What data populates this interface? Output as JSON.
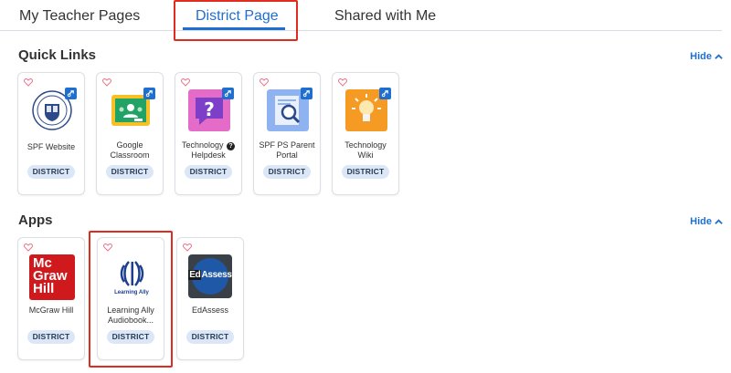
{
  "tabs": [
    {
      "label": "My Teacher Pages"
    },
    {
      "label": "District Page"
    },
    {
      "label": "Shared with Me"
    }
  ],
  "quick_links": {
    "title": "Quick Links",
    "hide_label": "Hide",
    "cards": [
      {
        "label": "SPF Website",
        "badge": "DISTRICT",
        "icon": "spf-seal-icon"
      },
      {
        "label": "Google Classroom",
        "badge": "DISTRICT",
        "icon": "google-classroom-icon"
      },
      {
        "label": "Technology",
        "badge": "DISTRICT",
        "icon": "helpdesk-question-icon"
      },
      {
        "label": "SPF PS Parent Portal",
        "badge": "DISTRICT",
        "icon": "parent-portal-magnifier-icon"
      },
      {
        "label": "Technology Wiki",
        "badge": "DISTRICT",
        "icon": "lightbulb-icon"
      }
    ],
    "helpdesk_second_line": "Helpdesk"
  },
  "apps": {
    "title": "Apps",
    "hide_label": "Hide",
    "cards": [
      {
        "label": "McGraw Hill",
        "badge": "DISTRICT",
        "icon": "mcgraw-hill-logo-icon",
        "logo_lines": [
          "Mc",
          "Graw",
          "Hill"
        ]
      },
      {
        "label": "Learning Ally Audiobook...",
        "badge": "DISTRICT",
        "icon": "learning-ally-logo-icon",
        "logo_text": "Learning Ally"
      },
      {
        "label": "EdAssess",
        "badge": "DISTRICT",
        "icon": "edassess-logo-icon",
        "logo_text_a": "Ed",
        "logo_text_b": "Assess"
      }
    ]
  },
  "colors": {
    "accent": "#1f6fd1",
    "highlight": "#e02b20",
    "pill_bg": "#dbe7f7"
  }
}
